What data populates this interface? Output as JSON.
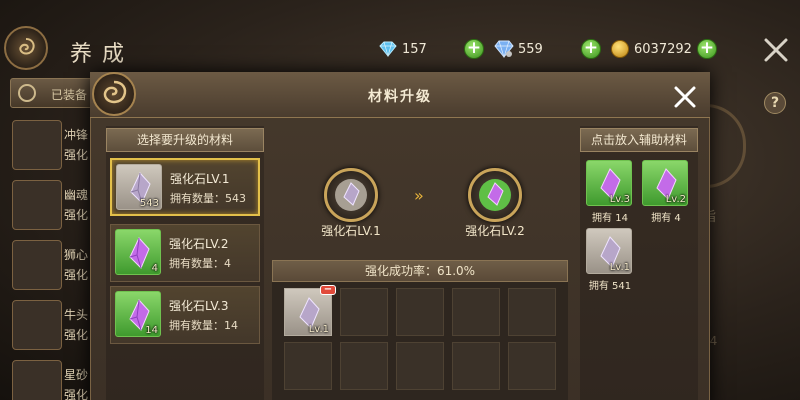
{
  "background": {
    "title": "养成",
    "tab_label": "已装备",
    "resources": [
      {
        "icon": "diamond-icon",
        "value": "157"
      },
      {
        "icon": "gem-icon",
        "value": "559"
      },
      {
        "icon": "gold-coin-icon",
        "value": "6037292"
      }
    ],
    "list_items": [
      {
        "line1": "冲锋",
        "line2": "强化"
      },
      {
        "line1": "幽魂",
        "line2": "强化"
      },
      {
        "line1": "狮心",
        "line2": "强化"
      },
      {
        "line1": "牛头",
        "line2": "强化"
      },
      {
        "line1": "星砂",
        "line2": "强化"
      }
    ],
    "help_label": "?",
    "right_text_1": "指",
    "right_text_2": "44"
  },
  "modal": {
    "title": "材料升级",
    "left_panel": {
      "header": "选择要升级的材料",
      "items": [
        {
          "name": "强化石LV.1",
          "count": "拥有数量：543",
          "tag": "543",
          "style": "grey",
          "selected": true
        },
        {
          "name": "强化石LV.2",
          "count": "拥有数量：4",
          "tag": "4",
          "style": "green",
          "selected": false
        },
        {
          "name": "强化石LV.3",
          "count": "拥有数量：14",
          "tag": "14",
          "style": "green",
          "selected": false
        }
      ]
    },
    "upgrade": {
      "from_label": "强化石LV.1",
      "to_label": "强化石LV.2",
      "arrow_glyph": "»",
      "rate_label": "强化成功率：61.0%"
    },
    "grid": {
      "filled_slot_tag": "Lv.1",
      "minus_label": "−"
    },
    "right_panel": {
      "header": "点击放入辅助材料",
      "items": [
        {
          "tag": "Lv.3",
          "count": "拥有 14",
          "style": "green"
        },
        {
          "tag": "Lv.2",
          "count": "拥有 4",
          "style": "green"
        },
        {
          "tag": "Lv.1",
          "count": "拥有 541",
          "style": "grey"
        }
      ]
    }
  }
}
